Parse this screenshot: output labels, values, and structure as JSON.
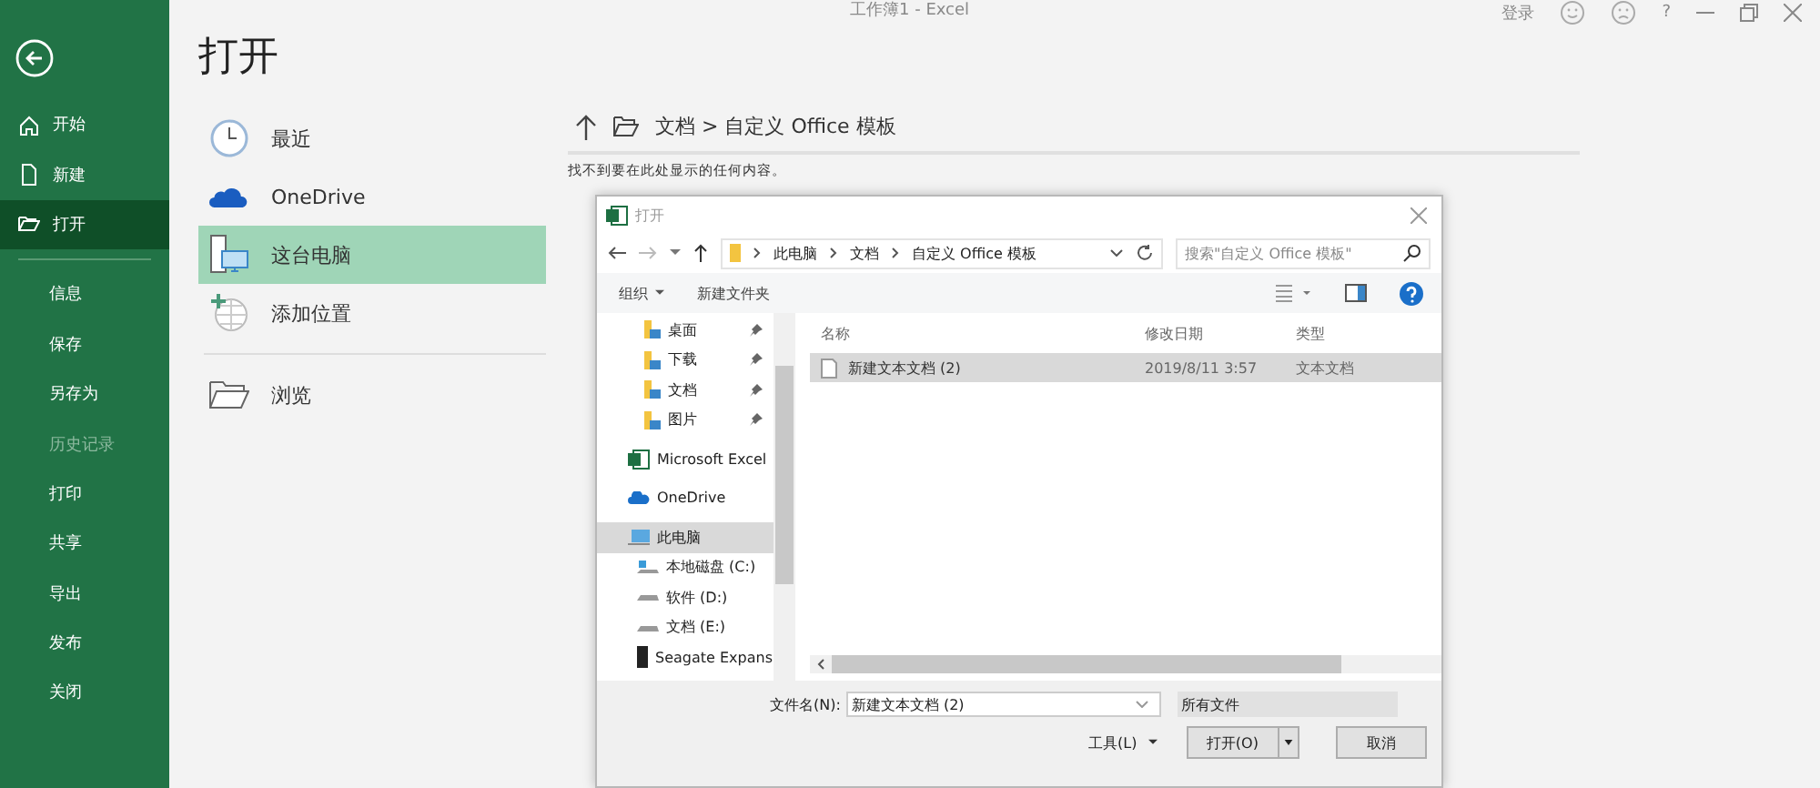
{
  "title_bar": {
    "title": "工作簿1 - Excel",
    "sign_in": "登录",
    "help": "?"
  },
  "sidebar": {
    "top_items": [
      {
        "label": "开始",
        "kind": "home",
        "selected": false
      },
      {
        "label": "新建",
        "kind": "new",
        "selected": false
      },
      {
        "label": "打开",
        "kind": "open",
        "selected": true
      }
    ],
    "items": [
      {
        "label": "信息",
        "disabled": false
      },
      {
        "label": "保存",
        "disabled": false
      },
      {
        "label": "另存为",
        "disabled": false
      },
      {
        "label": "历史记录",
        "disabled": true
      },
      {
        "label": "打印",
        "disabled": false
      },
      {
        "label": "共享",
        "disabled": false
      },
      {
        "label": "导出",
        "disabled": false
      },
      {
        "label": "发布",
        "disabled": false
      },
      {
        "label": "关闭",
        "disabled": false
      }
    ]
  },
  "page_title": "打开",
  "locations": [
    {
      "label": "最近",
      "kind": "recent",
      "selected": false
    },
    {
      "label": "OneDrive",
      "kind": "cloud",
      "selected": false
    },
    {
      "label": "这台电脑",
      "kind": "pc",
      "selected": true
    },
    {
      "label": "添加位置",
      "kind": "add",
      "selected": false
    }
  ],
  "browse": {
    "label": "浏览"
  },
  "path": "文档 > 自定义 Office 模板",
  "empty_message": "找不到要在此处显示的任何内容。",
  "dialog": {
    "title": "打开",
    "crumbs": [
      "此电脑",
      "文档",
      "自定义 Office 模板"
    ],
    "search": {
      "placeholder": "搜索\"自定义 Office 模板\""
    },
    "toolbar": {
      "organize": "组织",
      "new_folder": "新建文件夹"
    },
    "quick_access": [
      {
        "label": "桌面",
        "pinned": true
      },
      {
        "label": "下载",
        "pinned": true
      },
      {
        "label": "文档",
        "pinned": true
      },
      {
        "label": "图片",
        "pinned": true
      }
    ],
    "nav": [
      {
        "label": "Microsoft Excel",
        "kind": "excel",
        "selected": false
      },
      {
        "label": "OneDrive",
        "kind": "cloud",
        "selected": false
      },
      {
        "label": "此电脑",
        "kind": "pc",
        "selected": true,
        "children": [
          {
            "label": "本地磁盘 (C:)",
            "kind": "system"
          },
          {
            "label": "软件 (D:)",
            "kind": "drive"
          },
          {
            "label": "文档 (E:)",
            "kind": "drive"
          },
          {
            "label": "Seagate Expans",
            "kind": "usb"
          }
        ]
      }
    ],
    "columns": [
      "名称",
      "修改日期",
      "类型"
    ],
    "files": [
      {
        "name": "新建文本文档 (2)",
        "date": "2019/8/11 3:57",
        "type": "文本文档",
        "selected": true
      }
    ],
    "filename_label": "文件名(N):",
    "filename": "新建文本文档 (2)",
    "filter": "所有文件",
    "tools": "工具(L)",
    "open": "打开(O)",
    "cancel": "取消"
  }
}
